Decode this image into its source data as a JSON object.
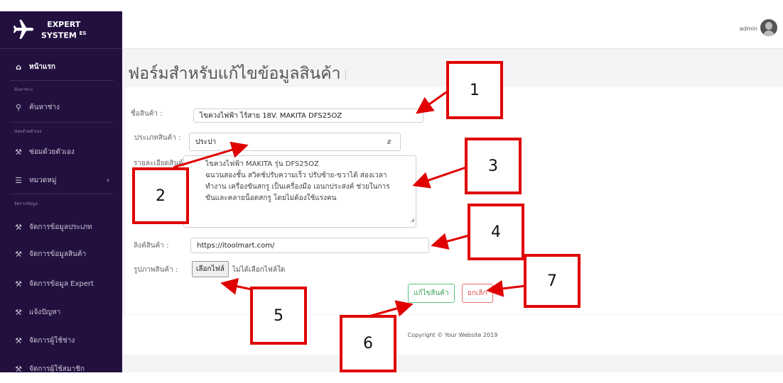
{
  "brand": {
    "line1": "EXPERT",
    "line2": "SYSTEM",
    "sup": "ES"
  },
  "sidebar": {
    "home": "หน้าแรก",
    "heading_search": "ค้นหาช่าง",
    "search_item": "ค้นหาช่าง",
    "heading_diy": "ซ่อมด้วยตัวเอง",
    "diy_item": "ซ่อมด้วยตัวเอง",
    "category_item": "หมวดหมู่",
    "heading_data": "จัดการข้อมูล",
    "items": [
      "จัดการข้อมูลประเภท",
      "จัดการข้อมูลสินค้า",
      "จัดการข้อมูล Expert",
      "แจ้งปัญหา",
      "จัดการผู้ใช้ช่าง",
      "จัดการผู้ใช้สมาชิก"
    ]
  },
  "header": {
    "user": "admin"
  },
  "page": {
    "title": "ฟอร์มสำหรับแก้ไขข้อมูลสินค้า"
  },
  "form": {
    "name_label": "ชื่อสินค้า :",
    "name_value": "ไขควงไฟฟ้า ไร้สาย 18V. MAKITA DFS25OZ",
    "type_label": "ประเภทสินค้า :",
    "type_value": "ประปา",
    "detail_label": "รายละเอียดสินค้า :",
    "detail_lines": [
      "ไขควงไฟฟ้า MAKITA รุ่น DFS25OZ",
      "ฉนวนสองชั้น สวิตช์ปรับความเร็ว ปรับซ้าย-ขวาได้ ส่องเวลา",
      "ทำงาน เครื่องขันสกรู เป็นเครื่องมือ เอนกประสงค์ ช่วยในการ",
      "ขันและคลายน็อตสกรู โดยไม่ต้องใช้แรงคน"
    ],
    "link_label": "ลิงค์สินค้า :",
    "link_value": "https://itoolmart.com/",
    "image_label": "รูปภาพสินค้า :",
    "file_button": "เลือกไฟล์",
    "file_status": "ไม่ได้เลือกไฟล์ใด",
    "edit_button": "แก้ไขสินค้า",
    "cancel_button": "ยกเลิก"
  },
  "footer": {
    "copyright": "Copyright © Your Website 2019"
  },
  "annotations": [
    "1",
    "2",
    "3",
    "4",
    "5",
    "6",
    "7"
  ],
  "colors": {
    "sidebar": "#23103f",
    "annotation": "#e00000",
    "edit": "#58c27a",
    "cancel": "#e2716b"
  }
}
